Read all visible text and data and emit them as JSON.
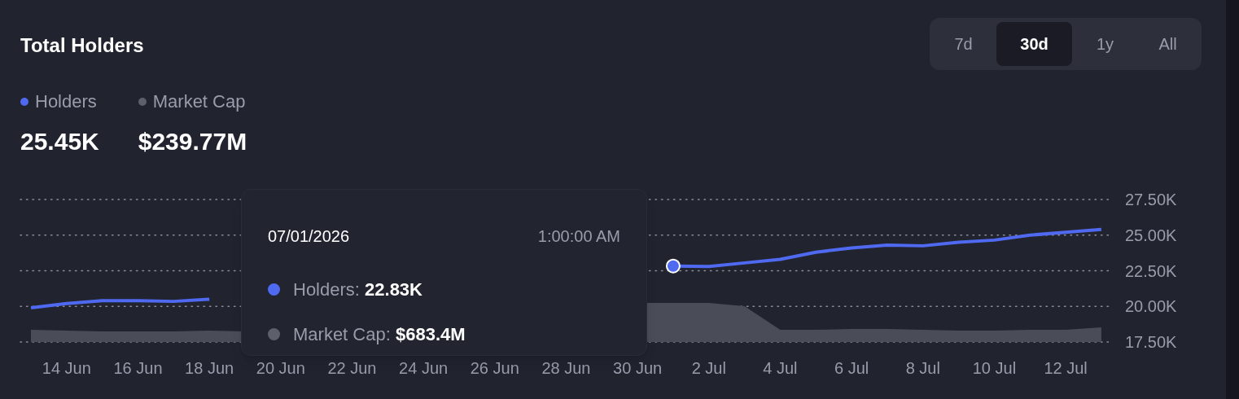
{
  "title": "Total Holders",
  "tabs": [
    {
      "label": "7d",
      "selected": false
    },
    {
      "label": "30d",
      "selected": true
    },
    {
      "label": "1y",
      "selected": false
    },
    {
      "label": "All",
      "selected": false
    }
  ],
  "legend": [
    {
      "label": "Holders",
      "color": "#4f6af0",
      "value": "25.45K"
    },
    {
      "label": "Market Cap",
      "color": "#5d5f6b",
      "value": "$239.77M"
    }
  ],
  "chart_data": {
    "type": "line",
    "categories": [
      null,
      "14 Jun",
      null,
      "16 Jun",
      null,
      "18 Jun",
      null,
      "20 Jun",
      null,
      "22 Jun",
      null,
      "24 Jun",
      null,
      "26 Jun",
      null,
      "28 Jun",
      null,
      "30 Jun",
      null,
      "2 Jul",
      null,
      "4 Jul",
      null,
      "6 Jul",
      null,
      "8 Jul",
      null,
      "10 Jul",
      null,
      "12 Jul",
      null
    ],
    "series": [
      {
        "color": "#4f6af0",
        "values": [
          19.9,
          20.2,
          20.4,
          20.4,
          20.35,
          20.5,
          null,
          null,
          null,
          null,
          null,
          null,
          null,
          null,
          null,
          null,
          null,
          null,
          22.83,
          22.8,
          23.05,
          23.3,
          23.8,
          24.1,
          24.3,
          24.25,
          24.5,
          24.65,
          25.0,
          25.2,
          25.4
        ]
      }
    ],
    "grid": true,
    "ylim": [
      17.5,
      27.5
    ],
    "yticks": [
      {
        "value": 27.5,
        "label": "27.50K"
      },
      {
        "value": 25,
        "label": "25.00K"
      },
      {
        "value": 22.5,
        "label": "22.50K"
      },
      {
        "value": 20,
        "label": "20.00K"
      },
      {
        "value": 17.5,
        "label": "17.50K"
      }
    ]
  },
  "tooltip": {
    "date": "07/01/2026",
    "time": "1:00:00 AM",
    "rows": [
      {
        "label": "Holders:",
        "value": "22.83K",
        "color": "#4f6af0"
      },
      {
        "label": "Market Cap:",
        "value": "$683.4M",
        "color": "#5d5f6b"
      }
    ]
  }
}
